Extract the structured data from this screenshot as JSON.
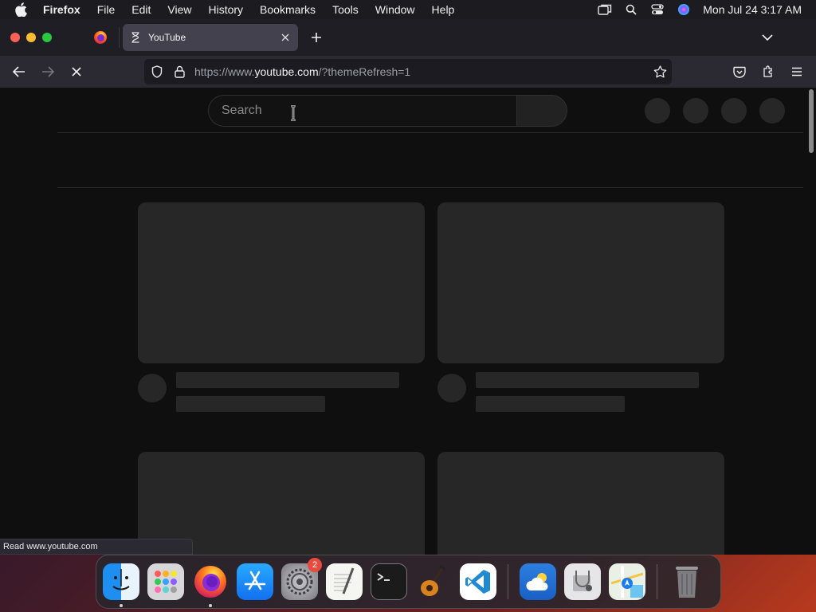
{
  "menubar": {
    "app_name": "Firefox",
    "items": [
      "File",
      "Edit",
      "View",
      "History",
      "Bookmarks",
      "Tools",
      "Window",
      "Help"
    ],
    "clock": "Mon Jul 24  3:17 AM"
  },
  "tabs": {
    "active_title": "YouTube"
  },
  "navbar": {
    "url_prefix": "https://www.",
    "url_domain": "youtube.com",
    "url_suffix": "/?themeRefresh=1"
  },
  "page": {
    "search_placeholder": "Search"
  },
  "status": {
    "text": "Read www.youtube.com"
  },
  "dock": {
    "settings_badge": "2"
  },
  "colors": {
    "page_bg": "#0f0f0f",
    "skeleton": "#272727",
    "toolbar": "#2b2a33"
  }
}
